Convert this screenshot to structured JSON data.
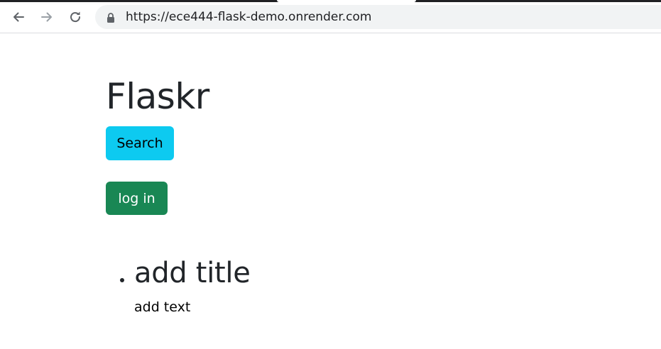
{
  "browser": {
    "url": "https://ece444-flask-demo.onrender.com",
    "back_icon": "arrow-left-icon",
    "forward_icon": "arrow-right-icon",
    "reload_icon": "reload-icon",
    "lock_icon": "lock-icon"
  },
  "page": {
    "title": "Flaskr",
    "search_label": "Search",
    "login_label": "log in"
  },
  "posts": [
    {
      "title": "add title",
      "body": "add text"
    }
  ],
  "colors": {
    "search_button": "#0dcaf0",
    "login_button": "#198754",
    "text": "#212529",
    "omnibox": "#f1f3f4"
  }
}
